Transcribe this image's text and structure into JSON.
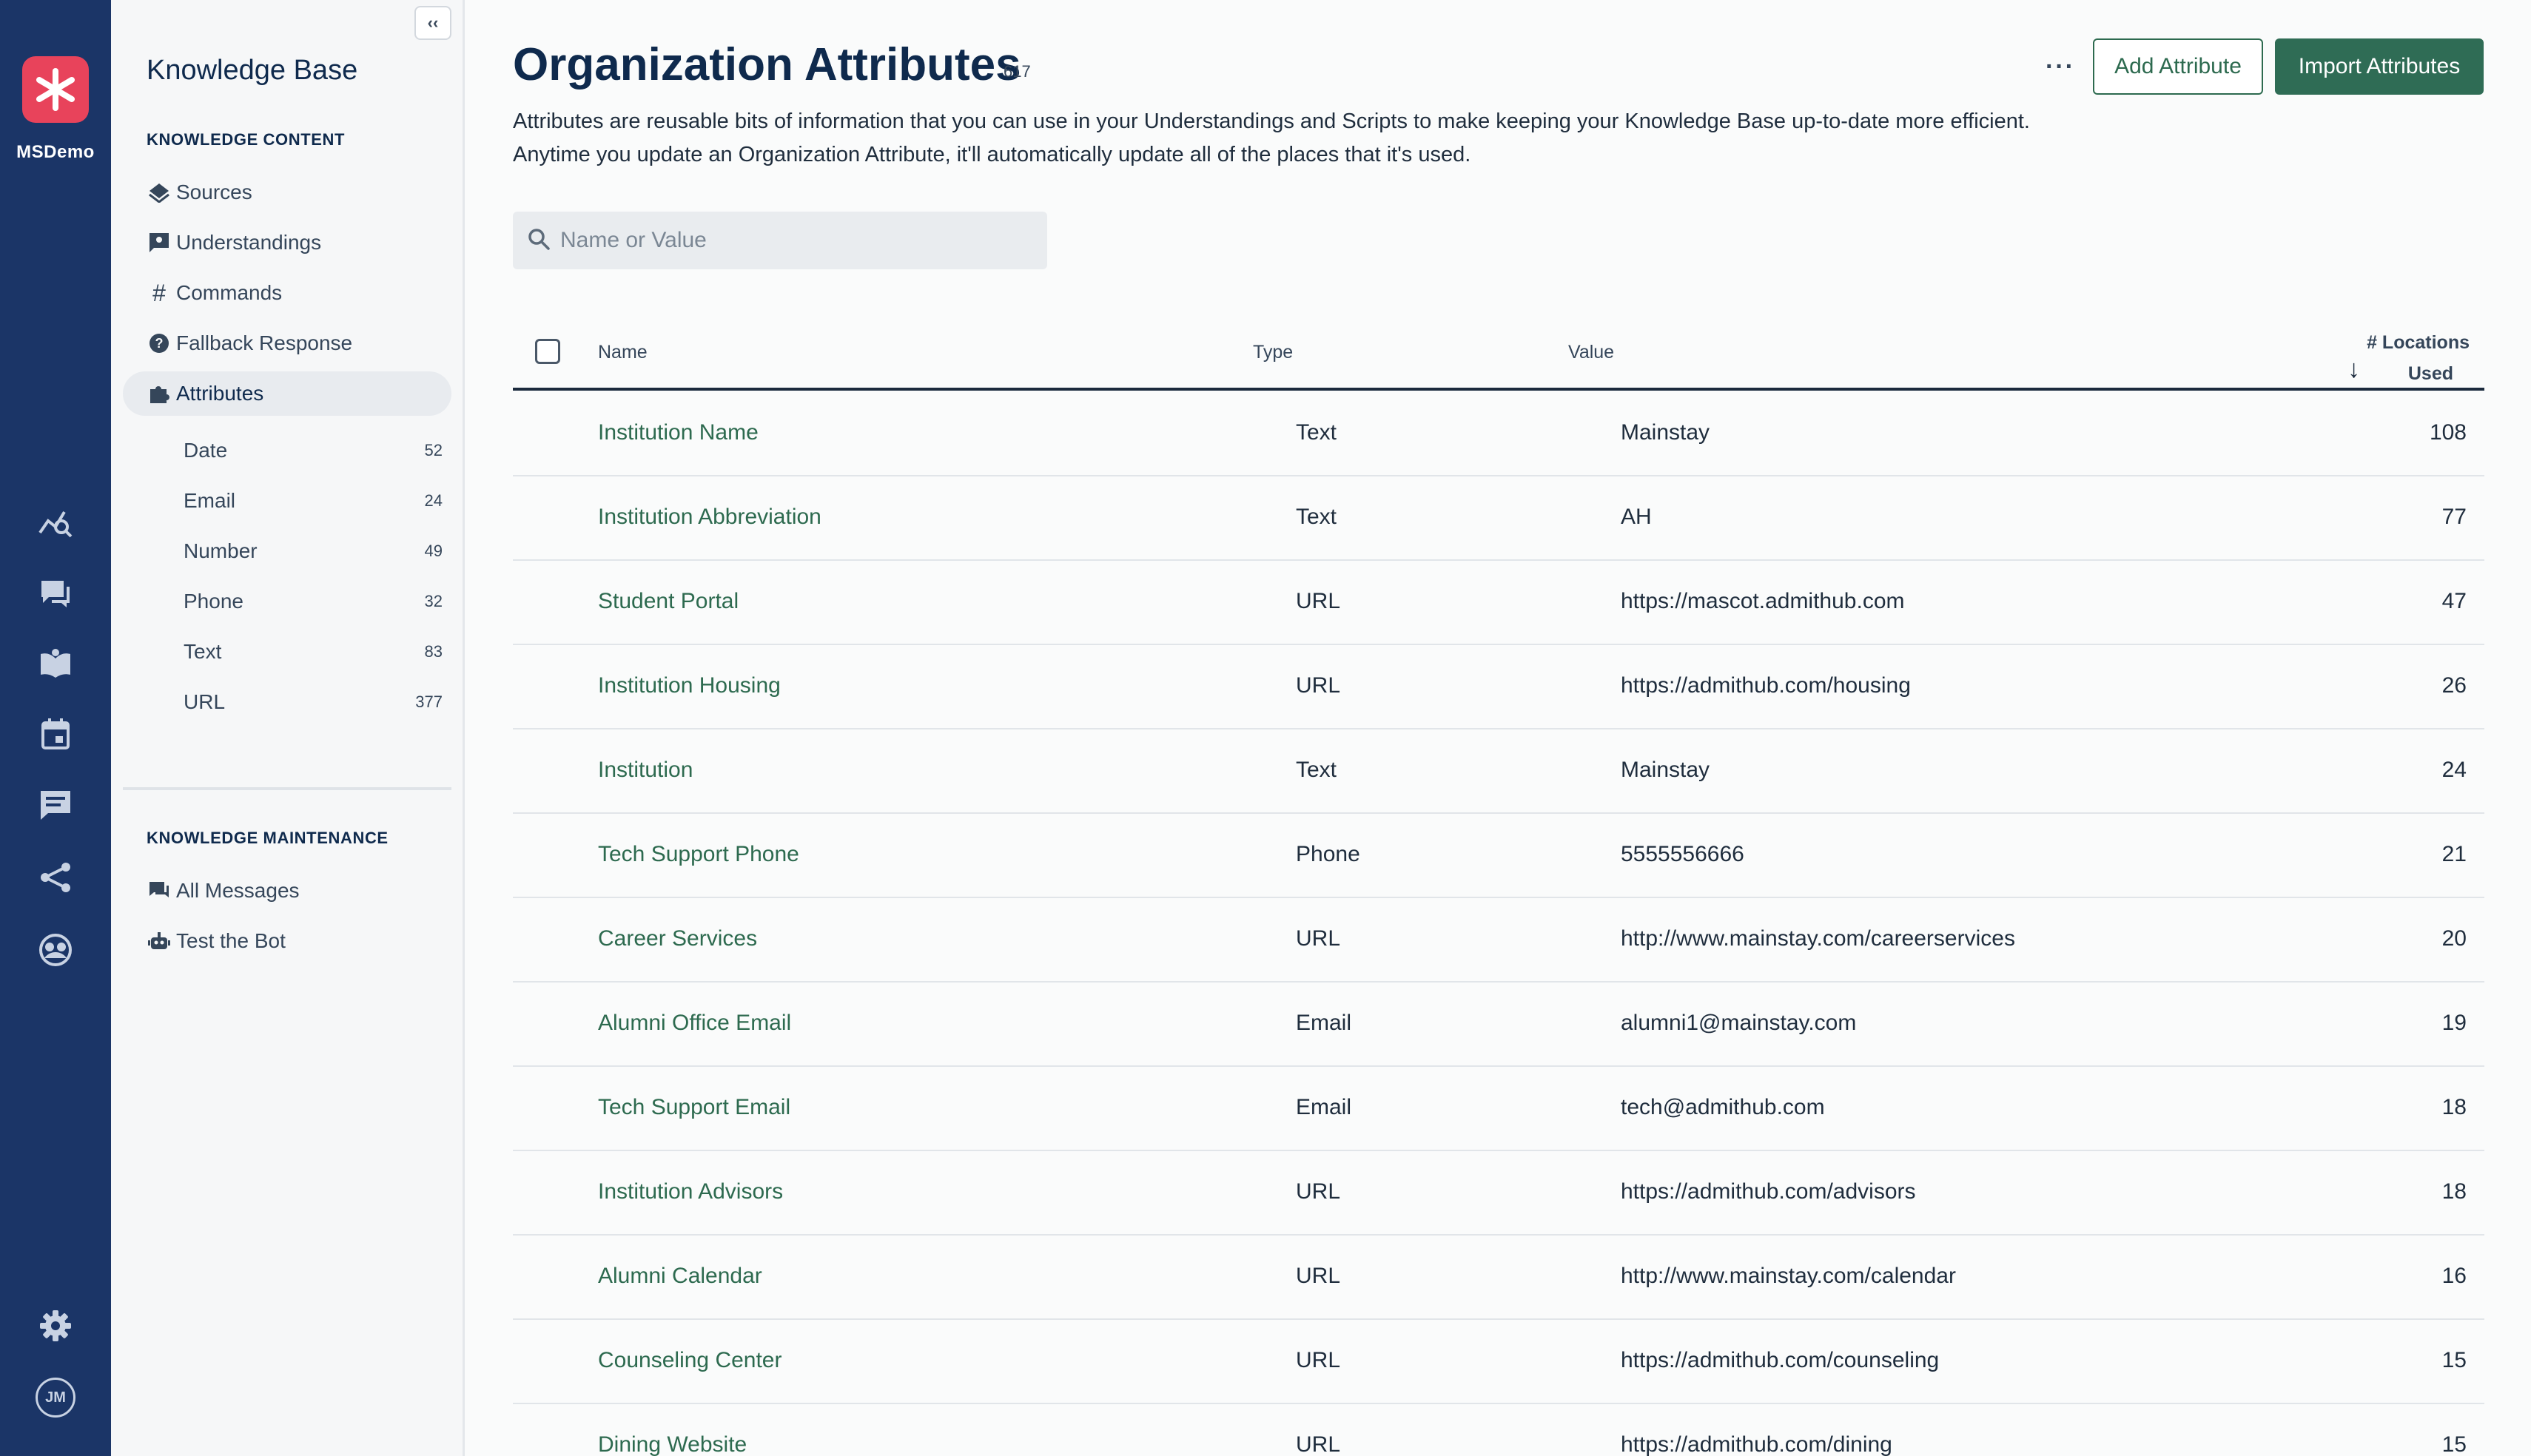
{
  "app": {
    "org_name": "MSDemo",
    "user_initials": "JM",
    "brand_color": "#e8435b",
    "rail_color": "#1b3567",
    "accent_green": "#2f6c55"
  },
  "sidebar": {
    "title": "Knowledge Base",
    "content_section": "KNOWLEDGE CONTENT",
    "content_items": [
      {
        "label": "Sources",
        "icon": "sources-icon"
      },
      {
        "label": "Understandings",
        "icon": "understandings-icon"
      },
      {
        "label": "Commands",
        "icon": "hash-icon"
      },
      {
        "label": "Fallback Response",
        "icon": "question-icon"
      },
      {
        "label": "Attributes",
        "icon": "puzzle-icon",
        "active": true
      }
    ],
    "attribute_types": [
      {
        "label": "Date",
        "count": "52"
      },
      {
        "label": "Email",
        "count": "24"
      },
      {
        "label": "Number",
        "count": "49"
      },
      {
        "label": "Phone",
        "count": "32"
      },
      {
        "label": "Text",
        "count": "83"
      },
      {
        "label": "URL",
        "count": "377"
      }
    ],
    "maintenance_section": "KNOWLEDGE MAINTENANCE",
    "maintenance_items": [
      {
        "label": "All Messages",
        "icon": "messages-icon"
      },
      {
        "label": "Test the Bot",
        "icon": "robot-icon"
      }
    ]
  },
  "header": {
    "title": "Organization Attributes",
    "count": "617",
    "description": "Attributes are reusable bits of information that you can use in your Understandings and Scripts to make keeping your Knowledge Base up-to-date more efficient. Anytime you update an Organization Attribute, it'll automatically update all of the places that it's used.",
    "more_label": "···",
    "add_label": "Add Attribute",
    "import_label": "Import Attributes"
  },
  "search": {
    "placeholder": "Name or Value",
    "value": ""
  },
  "table": {
    "columns": {
      "name": "Name",
      "type": "Type",
      "value": "Value",
      "locations_line1": "# Locations",
      "locations_line2": "Used"
    },
    "rows": [
      {
        "name": "Institution Name",
        "type": "Text",
        "value": "Mainstay",
        "locations": "108"
      },
      {
        "name": "Institution Abbreviation",
        "type": "Text",
        "value": "AH",
        "locations": "77"
      },
      {
        "name": "Student Portal",
        "type": "URL",
        "value": "https://mascot.admithub.com",
        "locations": "47"
      },
      {
        "name": "Institution Housing",
        "type": "URL",
        "value": "https://admithub.com/housing",
        "locations": "26"
      },
      {
        "name": "Institution",
        "type": "Text",
        "value": "Mainstay",
        "locations": "24"
      },
      {
        "name": "Tech Support Phone",
        "type": "Phone",
        "value": "5555556666",
        "locations": "21"
      },
      {
        "name": "Career Services",
        "type": "URL",
        "value": "http://www.mainstay.com/careerservices",
        "locations": "20"
      },
      {
        "name": "Alumni Office Email",
        "type": "Email",
        "value": "alumni1@mainstay.com",
        "locations": "19"
      },
      {
        "name": "Tech Support Email",
        "type": "Email",
        "value": "tech@admithub.com",
        "locations": "18"
      },
      {
        "name": "Institution Advisors",
        "type": "URL",
        "value": "https://admithub.com/advisors",
        "locations": "18"
      },
      {
        "name": "Alumni Calendar",
        "type": "URL",
        "value": "http://www.mainstay.com/calendar",
        "locations": "16"
      },
      {
        "name": "Counseling Center",
        "type": "URL",
        "value": "https://admithub.com/counseling",
        "locations": "15"
      },
      {
        "name": "Dining Website",
        "type": "URL",
        "value": "https://admithub.com/dining",
        "locations": "15"
      }
    ]
  }
}
